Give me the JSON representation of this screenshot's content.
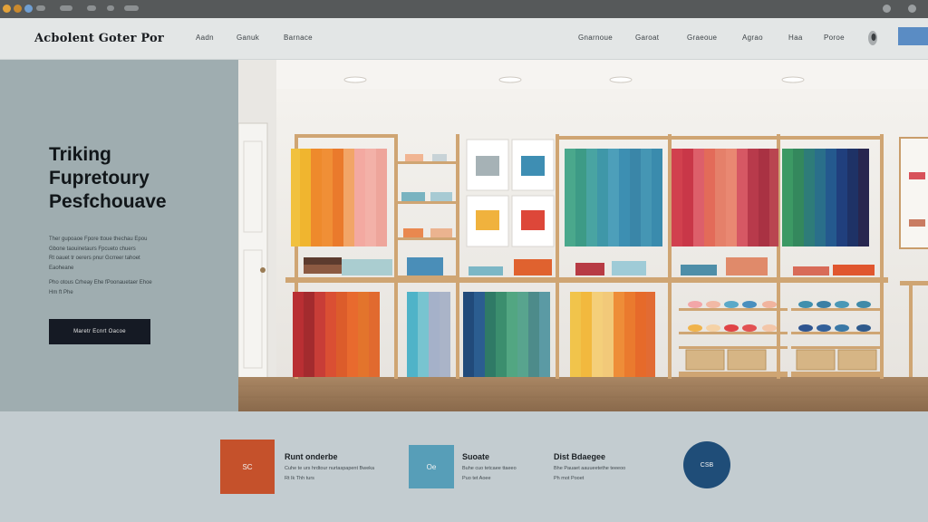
{
  "header": {
    "logo": "Acbolent Goter Por",
    "nav_left": [
      "Aadn",
      "Ganuk",
      "Barnace"
    ],
    "nav_right": [
      "Gnarnoue",
      "Garoat",
      "Graeoue",
      "Agrao",
      "Haa",
      "Poroe"
    ]
  },
  "hero": {
    "title_lines": [
      "Triking",
      "Fupretoury",
      "Pesfchouave"
    ],
    "body_lines": [
      "Ther gupoaoe Fpore ttoue thechau Epou",
      "Gbone taouinetaurs Fpcueto chuers",
      "Rt oauet tr oerers pnur Gcrreer tahoet",
      "Eaoheane",
      "Pho otous Crheay Ehe fPoonauetaer Ehoe",
      "Hm ft Phe"
    ],
    "cta_label": "Maretr Ecnrt Oacoe"
  },
  "showroom": {
    "wall_cards": [
      "swatch-card-1",
      "swatch-card-2",
      "swatch-card-3",
      "swatch-card-4"
    ]
  },
  "features": [
    {
      "badge": "SC",
      "title": "Runt onderbe",
      "lines": [
        "Cuhe te urs hrdtour nurtaspapent Bweka",
        "Rt Ik Thh turs"
      ],
      "color": "#c5512b"
    },
    {
      "badge": "Oe",
      "title": "Suoate",
      "lines": [
        "Buhe cuo tetcaee ttaeeo",
        "Puo tet Aoee"
      ],
      "color": "#579eb8"
    },
    {
      "badge": "",
      "title": "Dist Bdaegee",
      "lines": [
        "Bhe Pauaet aauueetethe teeeoo",
        "Ph mot Pooet"
      ],
      "color": ""
    },
    {
      "badge": "CSB",
      "title": "",
      "lines": [],
      "color": "#1f4d78"
    }
  ],
  "colors": {
    "accent_blue": "#5a8cc4",
    "cta_dark": "#151a24",
    "hero_panel": "#9fadb0",
    "wood": "#cfa573"
  }
}
